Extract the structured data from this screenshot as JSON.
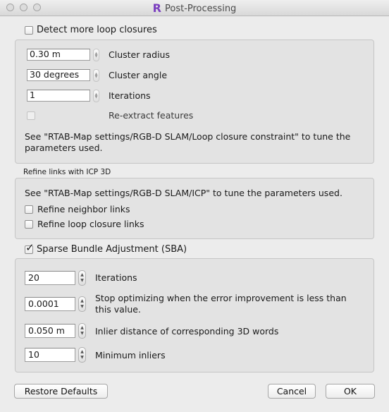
{
  "window": {
    "title": "Post-Processing",
    "app_icon": "R"
  },
  "loop": {
    "header": "Detect more loop closures",
    "checked": false,
    "cluster_radius_value": "0.30 m",
    "cluster_radius_label": "Cluster radius",
    "cluster_angle_value": "30 degrees",
    "cluster_angle_label": "Cluster angle",
    "iterations_value": "1",
    "iterations_label": "Iterations",
    "reextract_label": "Re-extract features",
    "note": "See \"RTAB-Map settings/RGB-D SLAM/Loop closure constraint\" to tune the parameters used."
  },
  "icp": {
    "header": "Refine links with ICP 3D",
    "note": "See \"RTAB-Map settings/RGB-D SLAM/ICP\" to tune the parameters used.",
    "neighbor_label": "Refine neighbor links",
    "loop_label": "Refine loop closure links"
  },
  "sba": {
    "header": "Sparse Bundle Adjustment (SBA)",
    "checked": true,
    "iterations_value": "20",
    "iterations_label": "Iterations",
    "epsilon_value": "0.0001",
    "epsilon_label": "Stop optimizing when the error improvement is less than this value.",
    "inlier_dist_value": "0.050 m",
    "inlier_dist_label": "Inlier distance of corresponding 3D words",
    "min_inliers_value": "10",
    "min_inliers_label": "Minimum inliers"
  },
  "buttons": {
    "restore": "Restore Defaults",
    "cancel": "Cancel",
    "ok": "OK"
  },
  "icons": {
    "checkmark": "✓",
    "spin_up": "▲",
    "spin_down": "▼"
  }
}
